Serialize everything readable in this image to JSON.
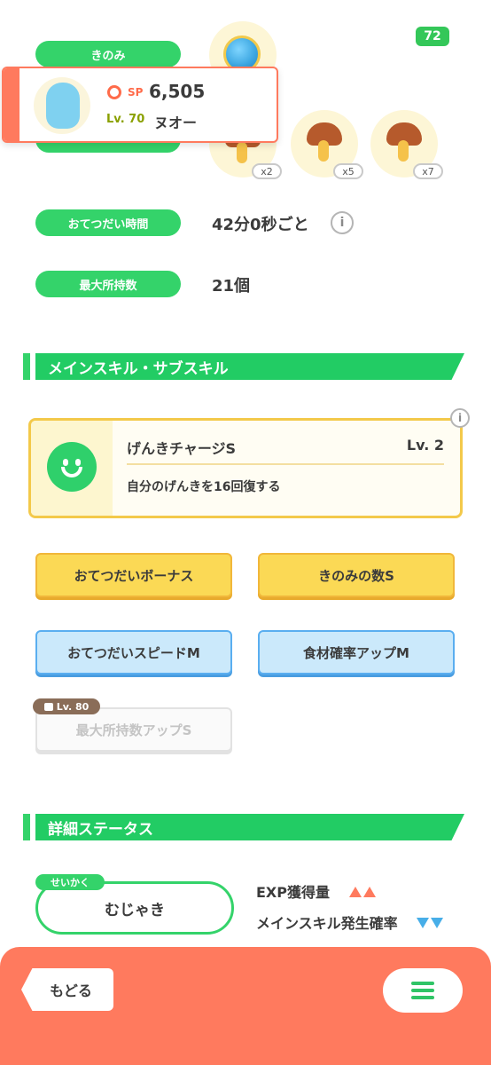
{
  "status_bar": {
    "battery": "72"
  },
  "info_rows": {
    "berry_label": "きのみ",
    "ingredients_counts": [
      "x2",
      "x5",
      "x7"
    ],
    "help_time_label": "おてつだい時間",
    "help_time_value": "42分0秒ごと",
    "max_carry_label": "最大所持数",
    "max_carry_value": "21個"
  },
  "pokemon_card": {
    "sp_label": "SP",
    "sp_value": "6,505",
    "level": "Lv. 70",
    "name": "ヌオー",
    "accent": "#ff7a5e"
  },
  "skills_section": {
    "title": "メインスキル・サブスキル",
    "main_skill": {
      "name": "げんきチャージS",
      "level": "Lv. 2",
      "description": "自分のげんきを16回復する",
      "icon": "smile-face-icon"
    },
    "sub_skills": [
      {
        "label": "おてつだいボーナス",
        "tier": "gold"
      },
      {
        "label": "きのみの数S",
        "tier": "gold"
      },
      {
        "label": "おてつだいスピードM",
        "tier": "blue"
      },
      {
        "label": "食材確率アップM",
        "tier": "blue"
      },
      {
        "label": "最大所持数アップS",
        "tier": "locked",
        "unlock": "Lv. 80"
      }
    ]
  },
  "status_section": {
    "title": "詳細ステータス",
    "nature_tag": "せいかく",
    "nature": "むじゃき",
    "up_stat": "EXP獲得量",
    "down_stat": "メインスキル発生確率"
  },
  "footer": {
    "back_label": "もどる",
    "menu_icon": "hamburger-menu-icon"
  },
  "colors": {
    "green": "#34d36a",
    "coral": "#ff7a5e",
    "gold": "#fbd955",
    "blue": "#cbe9fb"
  }
}
